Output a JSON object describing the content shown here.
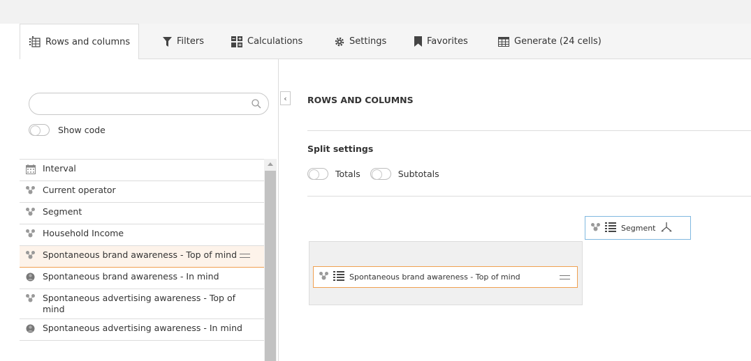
{
  "tabs": [
    {
      "label": "Rows and columns",
      "icon": "rows-columns-icon",
      "active": true
    },
    {
      "label": "Filters",
      "icon": "filter-icon"
    },
    {
      "label": "Calculations",
      "icon": "calculator-icon"
    },
    {
      "label": "Settings",
      "icon": "gear-icon"
    },
    {
      "label": "Favorites",
      "icon": "bookmark-icon"
    },
    {
      "label": "Generate (24 cells)",
      "icon": "table-icon"
    }
  ],
  "sidebar": {
    "search": {
      "placeholder": "",
      "value": ""
    },
    "show_code_label": "Show code",
    "items": [
      {
        "label": "Interval",
        "icon": "calendar-icon"
      },
      {
        "label": "Current operator",
        "icon": "tree-icon"
      },
      {
        "label": "Segment",
        "icon": "tree-icon"
      },
      {
        "label": "Household Income",
        "icon": "tree-icon"
      },
      {
        "label": "Spontaneous brand awareness - Top of mind",
        "icon": "tree-icon",
        "selected": true
      },
      {
        "label": "Spontaneous brand awareness - In mind",
        "icon": "head-icon"
      },
      {
        "label": "Spontaneous advertising awareness - Top of mind",
        "icon": "tree-icon"
      },
      {
        "label": "Spontaneous advertising awareness - In mind",
        "icon": "head-icon"
      }
    ]
  },
  "main": {
    "title": "ROWS AND COLUMNS",
    "split_settings_title": "Split settings",
    "totals_label": "Totals",
    "subtotals_label": "Subtotals",
    "column_chip": {
      "label": "Segment"
    },
    "row_chip": {
      "label": "Spontaneous brand awareness - Top of mind"
    }
  },
  "colors": {
    "accent_orange": "#f0a050",
    "accent_blue": "#7fb8e0",
    "selected_bg": "#fdf3ea"
  }
}
